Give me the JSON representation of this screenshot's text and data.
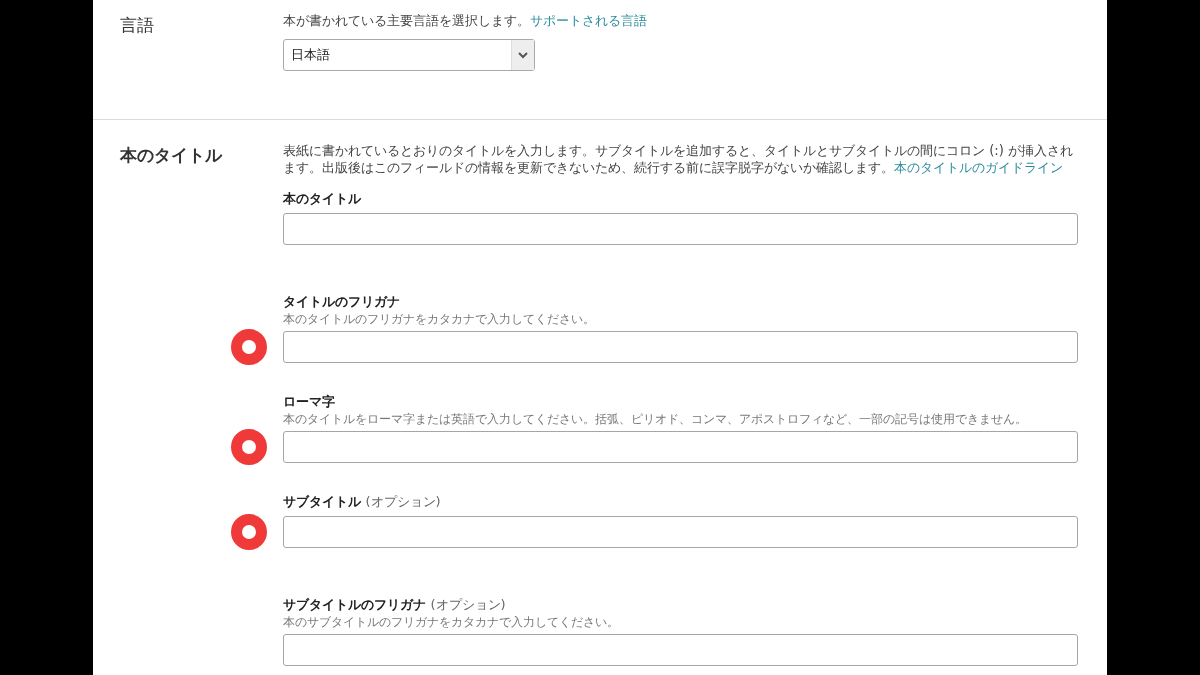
{
  "sections": [
    {
      "title": "言語",
      "description": "本が書かれている主要言語を選択します。",
      "link": "サポートされる言語",
      "select": {
        "value": "日本語"
      }
    },
    {
      "title": "本のタイトル",
      "description": "表紙に書かれているとおりのタイトルを入力します。サブタイトルを追加すると、タイトルとサブタイトルの間にコロン (:) が挿入されます。出版後はこのフィールドの情報を更新できないため、続行する前に誤字脱字がないか確認します。",
      "link": "本のタイトルのガイドライン",
      "fields": [
        {
          "label": "本のタイトル",
          "marked": false
        },
        {
          "label": "タイトルのフリガナ",
          "help": "本のタイトルのフリガナをカタカナで入力してください。",
          "marked": true
        },
        {
          "label": "ローマ字",
          "help": "本のタイトルをローマ字または英語で入力してください。括弧、ピリオド、コンマ、アポストロフィなど、一部の記号は使用できません。",
          "marked": true
        },
        {
          "label": "サブタイトル",
          "optional": "(オプション)",
          "marked": true
        },
        {
          "label": "サブタイトルのフリガナ",
          "optional": "(オプション)",
          "help": "本のサブタイトルのフリガナをカタカナで入力してください。",
          "marked": false
        }
      ]
    }
  ]
}
